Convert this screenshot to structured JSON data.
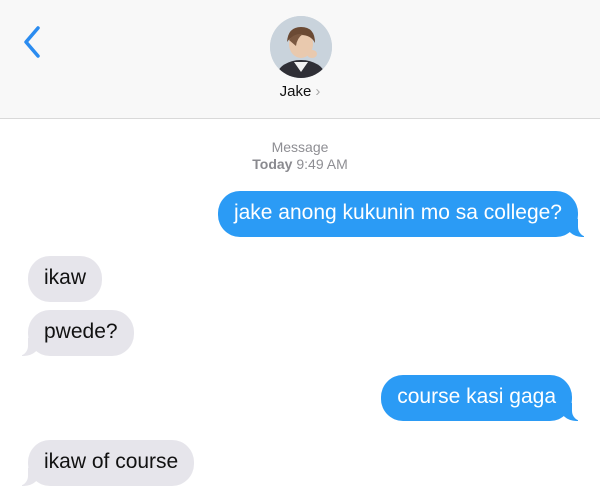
{
  "header": {
    "contact_name": "Jake",
    "chevron": "›",
    "back_icon": "chevron-left-icon",
    "accent": "#2b8cf0"
  },
  "thread_meta": {
    "service": "Message",
    "day": "Today",
    "time": "9:49 AM"
  },
  "messages": [
    {
      "direction": "sent",
      "text": "jake anong kukunin mo sa college?"
    },
    {
      "direction": "received",
      "text": "ikaw"
    },
    {
      "direction": "received",
      "text": "pwede?"
    },
    {
      "direction": "sent",
      "text": "course kasi gaga"
    },
    {
      "direction": "received",
      "text": "ikaw of course"
    }
  ],
  "colors": {
    "sent_bubble": "#2b9bf5",
    "received_bubble": "#e6e5eb",
    "header_bg": "#f8f8f8"
  }
}
